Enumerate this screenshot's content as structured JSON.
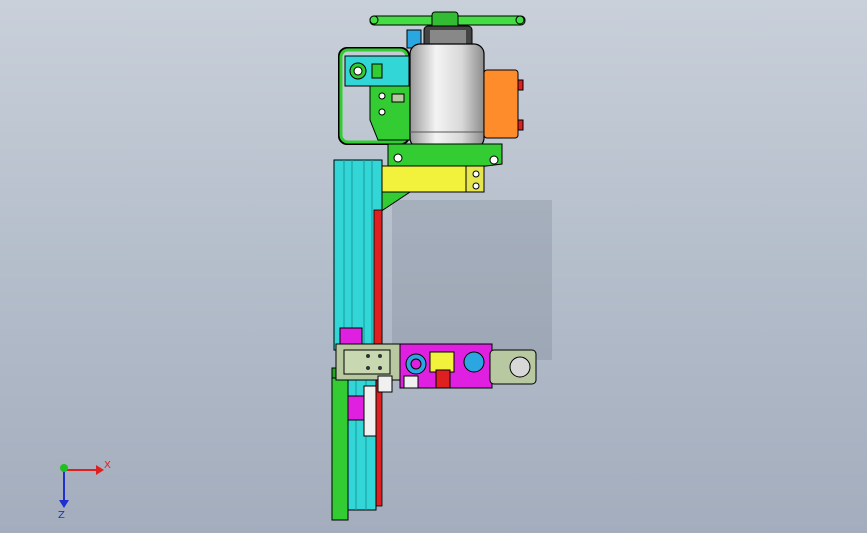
{
  "triad": {
    "x_label": "X",
    "z_label": "Z",
    "x_color": "#e02020",
    "z_color": "#2030d0",
    "y_color": "#20c020"
  },
  "palette": {
    "background_top": "#c9d0da",
    "background_bottom": "#a3adbd",
    "cyan": "#33d6d6",
    "green": "#33cc33",
    "bright_green": "#55ee55",
    "yellow": "#f2f23c",
    "orange": "#ff8c2a",
    "magenta": "#e020e0",
    "red": "#e02020",
    "white": "#f0f0f0",
    "silver": "#d8d8d8",
    "olive": "#b8c8a0"
  }
}
